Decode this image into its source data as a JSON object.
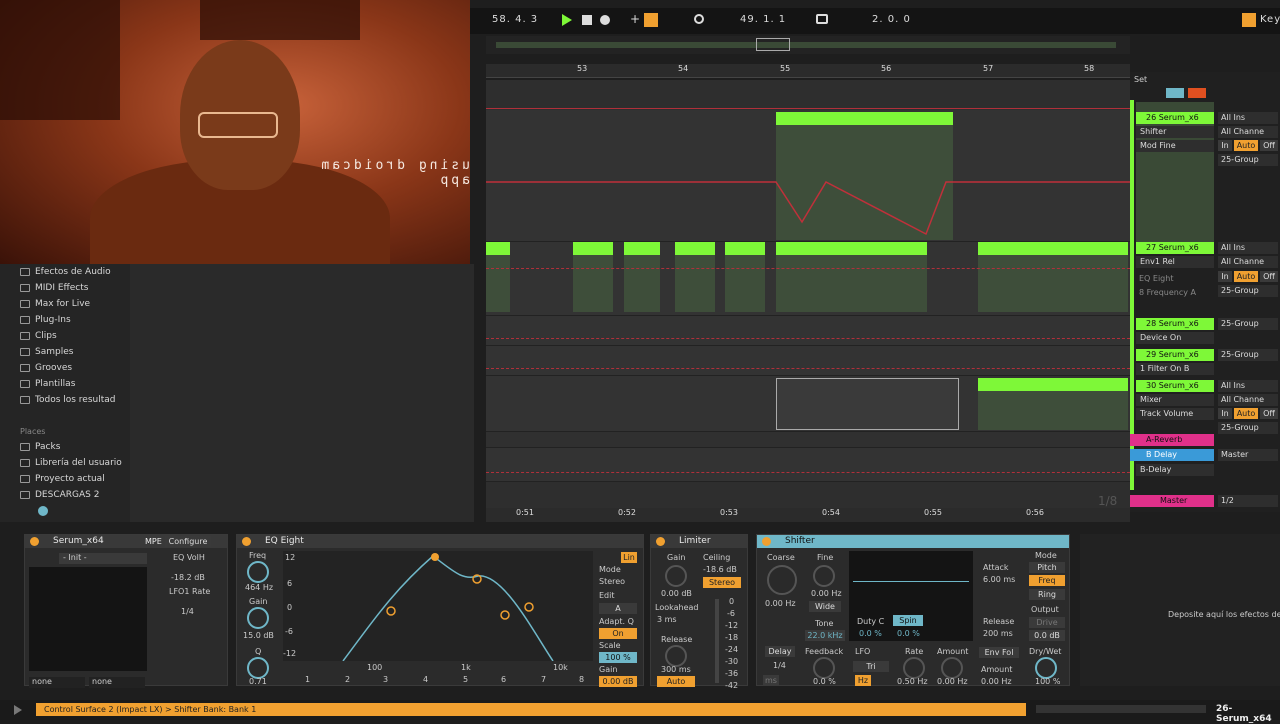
{
  "webcam": {
    "caption": "using droidcam app"
  },
  "transport": {
    "position": "58. 4. 3",
    "loop_start": "49. 1. 1",
    "loop_length": "2. 0. 0",
    "key_label": "Key"
  },
  "browser": {
    "categories": [
      "Efectos de Audio",
      "MIDI Effects",
      "Max for Live",
      "Plug-Ins",
      "Clips",
      "Samples",
      "Grooves",
      "Plantillas",
      "Todos los resultad"
    ],
    "places_label": "Places",
    "places": [
      "Packs",
      "Librería del usuario",
      "Proyecto actual",
      "DESCARGAS 2"
    ]
  },
  "ruler": {
    "bars": [
      "53",
      "54",
      "55",
      "56",
      "57",
      "58"
    ]
  },
  "timeline": {
    "times": [
      "0:51",
      "0:52",
      "0:53",
      "0:54",
      "0:55",
      "0:56"
    ],
    "zoom": "1/8"
  },
  "mixer": {
    "set_label": "Set",
    "tracks": [
      {
        "name": "26 Serum_x6",
        "input": "All Ins",
        "channel": "All Channe",
        "device": "Shifter",
        "param": "Mod Fine",
        "group": "25-Group",
        "in": "In",
        "auto": "Auto",
        "off": "Off"
      },
      {
        "name": "27 Serum_x6",
        "input": "All Ins",
        "channel": "All Channe",
        "device": "Env1 Rel",
        "extra1": "EQ Eight",
        "extra2": "8 Frequency A",
        "group": "25-Group",
        "in": "In",
        "auto": "Auto",
        "off": "Off"
      },
      {
        "name": "28 Serum_x6",
        "device": "Device On",
        "group": "25-Group"
      },
      {
        "name": "29 Serum_x6",
        "device": "1 Filter On B",
        "group": "25-Group"
      },
      {
        "name": "30 Serum_x6",
        "input": "All Ins",
        "channel": "All Channe",
        "device": "Mixer",
        "param": "Track Volume",
        "group": "25-Group",
        "in": "In",
        "auto": "Auto",
        "off": "Off"
      }
    ],
    "return_a": "A-Reverb",
    "return_b": "B Delay",
    "return_b_device": "B-Delay",
    "return_b_out": "Master",
    "master": "Master",
    "master_out": "1/2"
  },
  "devices": {
    "serum": {
      "title": "Serum_x64",
      "mpe": "MPE",
      "configure": "Configure",
      "preset": "- Init -",
      "param1": "EQ VolH",
      "val1": "-18.2 dB",
      "param2": "LFO1 Rate",
      "val2": "1/4",
      "sel1": "none",
      "sel2": "none"
    },
    "eq": {
      "title": "EQ Eight",
      "freq_label": "Freq",
      "freq": "464 Hz",
      "gain_label": "Gain",
      "gain": "15.0 dB",
      "q_label": "Q",
      "q": "0.71",
      "db_ticks": [
        "12",
        "6",
        "0",
        "-6",
        "-12"
      ],
      "hz_ticks": [
        "100",
        "1k",
        "10k"
      ],
      "bands": [
        "1",
        "2",
        "3",
        "4",
        "5",
        "6",
        "7",
        "8"
      ],
      "mode_label": "Mode",
      "mode": "Stereo",
      "edit_label": "Edit",
      "edit": "A",
      "adaptq_label": "Adapt. Q",
      "adaptq": "On",
      "scale_label": "Scale",
      "scale": "100 %",
      "gain2_label": "Gain",
      "gain2": "0.00 dB",
      "lin": "Lin"
    },
    "limiter": {
      "title": "Limiter",
      "gain_label": "Gain",
      "gain": "0.00 dB",
      "ceiling_label": "Ceiling",
      "ceiling": "-18.6 dB",
      "stereo": "Stereo",
      "lookahead_label": "Lookahead",
      "lookahead": "3 ms",
      "release_label": "Release",
      "release": "300 ms",
      "auto": "Auto",
      "meter": [
        "0",
        "-6",
        "-12",
        "-18",
        "-24",
        "-30",
        "-36",
        "-42"
      ]
    },
    "shifter": {
      "title": "Shifter",
      "coarse_label": "Coarse",
      "coarse": "0.00 Hz",
      "fine_label": "Fine",
      "fine": "0.00 Hz",
      "wide": "Wide",
      "tone_label": "Tone",
      "tone": "22.0 kHz",
      "duty_label": "Duty C",
      "duty": "0.0 %",
      "spin": "Spin",
      "spin_val": "0.0 %",
      "attack_label": "Attack",
      "attack": "6.00 ms",
      "release_label": "Release",
      "release": "200 ms",
      "mode_label": "Mode",
      "modes": [
        "Pitch",
        "Freq",
        "Ring"
      ],
      "output_label": "Output",
      "drive": "Drive",
      "output": "0.0 dB",
      "delay": "Delay",
      "delay_val": "1/4",
      "ms": "ms",
      "feedback_label": "Feedback",
      "feedback": "0.0 %",
      "lfo_label": "LFO",
      "lfo_wave": "Tri",
      "hz": "Hz",
      "rate_label": "Rate",
      "rate": "0.50 Hz",
      "amount_label": "Amount",
      "amount": "0.00 Hz",
      "envfol": "Env Fol",
      "amount2_label": "Amount",
      "amount2": "0.00 Hz",
      "drywet_label": "Dry/Wet",
      "drywet": "100 %"
    },
    "drop_hint": "Deposite aquí los efectos de"
  },
  "status": {
    "text": "Control Surface 2 (Impact LX) > Shifter Bank: Bank 1",
    "track": "26-Serum_x64"
  },
  "colors": {
    "clip_green": "#7ef838",
    "accent_orange": "#f0a030",
    "accent_blue": "#6fb7c8",
    "automation_red": "#b0303a",
    "return_pink": "#e0308a"
  }
}
